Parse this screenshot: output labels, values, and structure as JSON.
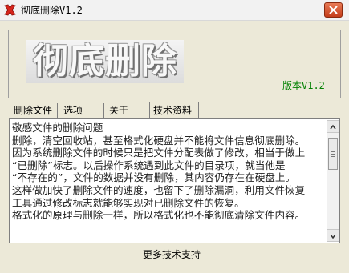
{
  "window": {
    "title": "彻底删除V1.2"
  },
  "header": {
    "logo_text": "彻底删除",
    "version": "版本V1.2"
  },
  "tabs": [
    {
      "label": "删除文件",
      "active": false
    },
    {
      "label": "选项",
      "active": false
    },
    {
      "label": "关于",
      "active": false
    },
    {
      "label": "技术资料",
      "active": true
    }
  ],
  "content": {
    "lines": [
      "敬感文件的删除问题",
      "删除，清空回收站，甚至格式化硬盘并不能将文件信息彻底删除。",
      "因为系统删除文件的时候只是把文件分配表做了修改，相当于做上",
      "“已删除”标志。以后操作系统遇到此文件的目录项，就当他是",
      "“不存在的”，文件的数据并没有删除，其内容仍存在在硬盘上。",
      "这样做加快了删除文件的速度，也留下了删除漏洞，利用文件恢复",
      "工具通过修改标志就能够实现对已删除文件的恢复。",
      "格式化的原理与删除一样，所以格式化也不能彻底清除文件内容。"
    ]
  },
  "footer": {
    "more_link": "更多技术支持"
  },
  "colors": {
    "window_bg": "#ece9d8",
    "version_text": "#008000",
    "close_button": "#c43d1a"
  }
}
